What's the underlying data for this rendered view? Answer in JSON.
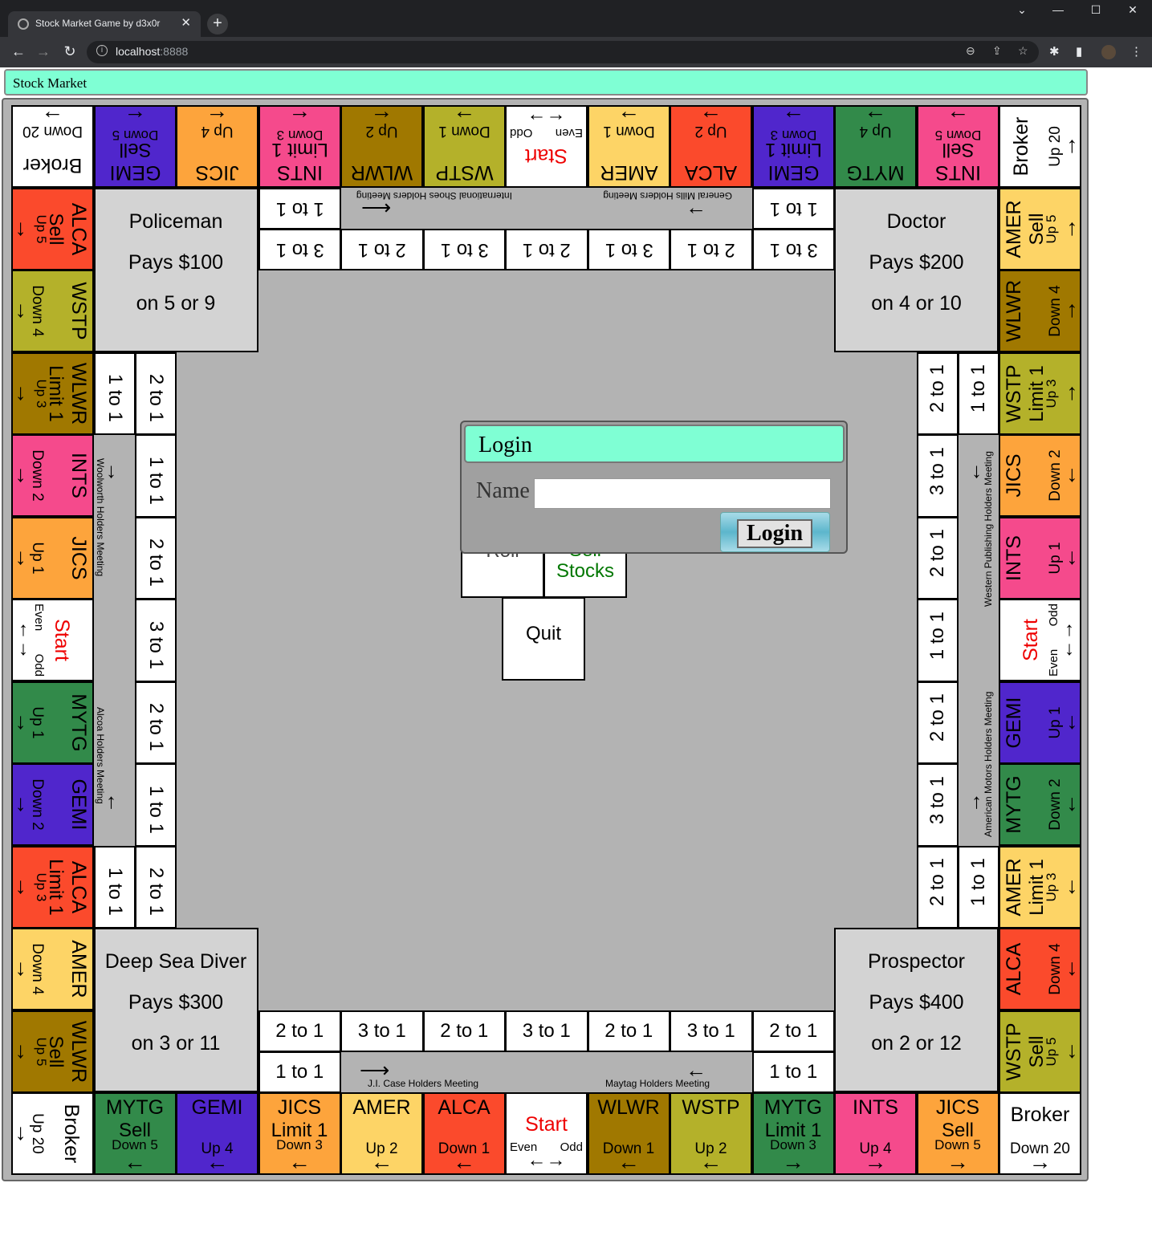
{
  "browser": {
    "tab_title": "Stock Market Game by d3x0r",
    "close_glyph": "✕",
    "new_tab_glyph": "+",
    "url_host": "localhost",
    "url_port": ":8888",
    "minimize_glyph": "—",
    "maximize_glyph": "☐",
    "close_window_glyph": "✕",
    "chevron_glyph": "⌄"
  },
  "app": {
    "title": "Stock Market"
  },
  "squares": {
    "top": [
      {
        "type": "broker",
        "name": "Broker",
        "move": "Down 20",
        "arrow": "→"
      },
      {
        "type": "stock",
        "name": "GEMI",
        "color": "#5026cc",
        "action": "Sell",
        "move": "Down 5",
        "arrow": "←"
      },
      {
        "type": "stock",
        "name": "JICS",
        "color": "#fda43c",
        "move": "Up 4",
        "arrow": "←"
      },
      {
        "type": "stock",
        "name": "INTS",
        "color": "#f54a8c",
        "action": "Limit 1",
        "move": "Down 3",
        "arrow": "←"
      },
      {
        "type": "stock",
        "name": "WLWR",
        "color": "#a07800",
        "move": "Up 2",
        "arrow": "←"
      },
      {
        "type": "stock",
        "name": "WSTP",
        "color": "#b4b12a",
        "move": "Down 1",
        "arrow": "→"
      },
      {
        "type": "start",
        "name": "Start",
        "even": "Even",
        "odd": "Odd",
        "arrow": "←→"
      },
      {
        "type": "stock",
        "name": "AMER",
        "color": "#fdd466",
        "move": "Down 1",
        "arrow": "→"
      },
      {
        "type": "stock",
        "name": "ALCA",
        "color": "#fb4a2c",
        "move": "Up 2",
        "arrow": "→"
      },
      {
        "type": "stock",
        "name": "GEMI",
        "color": "#5026cc",
        "action": "Limit 1",
        "move": "Down 3",
        "arrow": "→"
      },
      {
        "type": "stock",
        "name": "MYTG",
        "color": "#328a4a",
        "move": "Up 4",
        "arrow": "→"
      },
      {
        "type": "stock",
        "name": "INTS",
        "color": "#f54a8c",
        "action": "Sell",
        "move": "Down 5",
        "arrow": "→"
      },
      {
        "type": "broker",
        "name": "Broker",
        "move": "Up 20",
        "arrow": "→"
      }
    ],
    "right": [
      {
        "type": "stock",
        "name": "AMER",
        "color": "#fdd466",
        "action": "Sell",
        "move": "Up 5",
        "arrow": "→"
      },
      {
        "type": "stock",
        "name": "WLWR",
        "color": "#a07800",
        "move": "Down 4",
        "arrow": "→"
      },
      {
        "type": "stock",
        "name": "WSTP",
        "color": "#b4b12a",
        "action": "Limit 1",
        "move": "Up 3",
        "arrow": "→"
      },
      {
        "type": "stock",
        "name": "JICS",
        "color": "#fda43c",
        "move": "Down 2",
        "arrow": "←"
      },
      {
        "type": "stock",
        "name": "INTS",
        "color": "#f54a8c",
        "move": "Up 1",
        "arrow": "←"
      },
      {
        "type": "start",
        "name": "Start",
        "even": "Even",
        "odd": "Odd",
        "arrow": "←→"
      },
      {
        "type": "stock",
        "name": "GEMI",
        "color": "#5026cc",
        "move": "Up 1",
        "arrow": "←"
      },
      {
        "type": "stock",
        "name": "MYTG",
        "color": "#328a4a",
        "move": "Down 2",
        "arrow": "←"
      },
      {
        "type": "stock",
        "name": "AMER",
        "color": "#fdd466",
        "action": "Limit 1",
        "move": "Up 3",
        "arrow": "←"
      },
      {
        "type": "stock",
        "name": "ALCA",
        "color": "#fb4a2c",
        "move": "Down 4",
        "arrow": "←"
      },
      {
        "type": "stock",
        "name": "WSTP",
        "color": "#b4b12a",
        "action": "Sell",
        "move": "Up 5",
        "arrow": "←"
      }
    ],
    "bottom": [
      {
        "type": "broker",
        "name": "Broker",
        "move": "Up 20",
        "arrow": "→"
      },
      {
        "type": "stock",
        "name": "MYTG",
        "color": "#328a4a",
        "action": "Sell",
        "move": "Down 5",
        "arrow": "←"
      },
      {
        "type": "stock",
        "name": "GEMI",
        "color": "#5026cc",
        "move": "Up 4",
        "arrow": "←"
      },
      {
        "type": "stock",
        "name": "JICS",
        "color": "#fda43c",
        "action": "Limit 1",
        "move": "Down 3",
        "arrow": "←"
      },
      {
        "type": "stock",
        "name": "AMER",
        "color": "#fdd466",
        "move": "Up 2",
        "arrow": "←"
      },
      {
        "type": "stock",
        "name": "ALCA",
        "color": "#fb4a2c",
        "move": "Down 1",
        "arrow": "←"
      },
      {
        "type": "start",
        "name": "Start",
        "even": "Even",
        "odd": "Odd",
        "arrow": "←→"
      },
      {
        "type": "stock",
        "name": "WLWR",
        "color": "#a07800",
        "move": "Down 1",
        "arrow": "←"
      },
      {
        "type": "stock",
        "name": "WSTP",
        "color": "#b4b12a",
        "move": "Up 2",
        "arrow": "←"
      },
      {
        "type": "stock",
        "name": "MYTG",
        "color": "#328a4a",
        "action": "Limit 1",
        "move": "Down 3",
        "arrow": "→"
      },
      {
        "type": "stock",
        "name": "INTS",
        "color": "#f54a8c",
        "move": "Up 4",
        "arrow": "→"
      },
      {
        "type": "stock",
        "name": "JICS",
        "color": "#fda43c",
        "action": "Sell",
        "move": "Down 5",
        "arrow": "→"
      },
      {
        "type": "broker",
        "name": "Broker",
        "move": "Down 20",
        "arrow": "→"
      }
    ],
    "left": [
      {
        "type": "stock",
        "name": "ALCA",
        "color": "#fb4a2c",
        "action": "Sell",
        "move": "Up 5",
        "arrow": "→"
      },
      {
        "type": "stock",
        "name": "WSTP",
        "color": "#b4b12a",
        "move": "Down 4",
        "arrow": "→"
      },
      {
        "type": "stock",
        "name": "WLWR",
        "color": "#a07800",
        "action": "Limit 1",
        "move": "Up 3",
        "arrow": "→"
      },
      {
        "type": "stock",
        "name": "INTS",
        "color": "#f54a8c",
        "move": "Down 2",
        "arrow": "→"
      },
      {
        "type": "stock",
        "name": "JICS",
        "color": "#fda43c",
        "move": "Up 1",
        "arrow": "→"
      },
      {
        "type": "start",
        "name": "Start",
        "even": "Even",
        "odd": "Odd",
        "arrow": "←→"
      },
      {
        "type": "stock",
        "name": "MYTG",
        "color": "#328a4a",
        "move": "Up 1",
        "arrow": "→"
      },
      {
        "type": "stock",
        "name": "GEMI",
        "color": "#5026cc",
        "move": "Down 2",
        "arrow": "→"
      },
      {
        "type": "stock",
        "name": "ALCA",
        "color": "#fb4a2c",
        "action": "Limit 1",
        "move": "Up 3",
        "arrow": "→"
      },
      {
        "type": "stock",
        "name": "AMER",
        "color": "#fdd466",
        "move": "Down 4",
        "arrow": "→"
      },
      {
        "type": "stock",
        "name": "WLWR",
        "color": "#a07800",
        "action": "Sell",
        "move": "Up 5",
        "arrow": "→"
      }
    ]
  },
  "corners": {
    "tl": {
      "title": "Policeman",
      "pays": "Pays $100",
      "on": "on 5 or 9"
    },
    "tr": {
      "title": "Doctor",
      "pays": "Pays $200",
      "on": "on 4 or 10"
    },
    "bl": {
      "title": "Deep Sea Diver",
      "pays": "Pays $300",
      "on": "on 3 or 11"
    },
    "br": {
      "title": "Prospector",
      "pays": "Pays $400",
      "on": "on 2 or 12"
    }
  },
  "inner": {
    "top_outer": [
      "3 to 1",
      "2 to 1",
      "3 to 1",
      "2 to 1",
      "3 to 1",
      "2 to 1",
      "3 to 1"
    ],
    "top_inner": [
      "1 to 1",
      "1 to 1"
    ],
    "bottom_outer": [
      "2 to 1",
      "3 to 1",
      "2 to 1",
      "3 to 1",
      "2 to 1",
      "3 to 1",
      "2 to 1"
    ],
    "bottom_inner": [
      "1 to 1",
      "1 to 1"
    ],
    "left_outer": [
      "2 to 1",
      "1 to 1",
      "2 to 1",
      "3 to 1",
      "2 to 1",
      "1 to 1",
      "2 to 1"
    ],
    "left_inner": [
      "1 to 1",
      "1 to 1"
    ],
    "right_outer": [
      "2 to 1",
      "3 to 1",
      "2 to 1",
      "1 to 1",
      "2 to 1",
      "3 to 1",
      "2 to 1"
    ],
    "right_inner": [
      "1 to 1",
      "1 to 1"
    ]
  },
  "meetings": {
    "top_right": "General Mills Holders Meeting",
    "top_left": "International Shoes Holders Meeting",
    "left_top": "Woolworth Holders Meeting",
    "left_bottom": "Alcoa Holders Meeting",
    "right_top": "Western Publishing Holders Meeting",
    "right_bottom": "American Motors Holders Meeting",
    "bottom_left": "J.I. Case Holders Meeting",
    "bottom_right": "Maytag Holders Meeting"
  },
  "controls": {
    "roll": "Roll",
    "sell_line1": "Sell",
    "sell_line2": "Stocks",
    "quit": "Quit"
  },
  "login": {
    "title": "Login",
    "name_label": "Name",
    "name_value": "",
    "button": "Login"
  }
}
